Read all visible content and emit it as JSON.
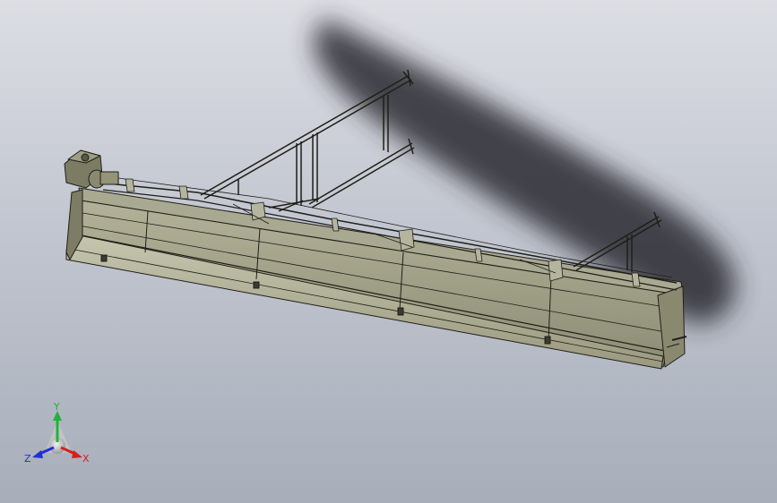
{
  "viewport": {
    "background_top": "#dcdee4",
    "background_bottom": "#a7aeba"
  },
  "model": {
    "body_color": "#9d9c82",
    "edge_color": "#1f1f18",
    "shadow_color": "#2a2c30"
  },
  "triad": {
    "x_label": "X",
    "y_label": "Y",
    "z_label": "Z",
    "x_color": "#d42020",
    "y_color": "#1eb43a",
    "z_color": "#2030d0"
  }
}
